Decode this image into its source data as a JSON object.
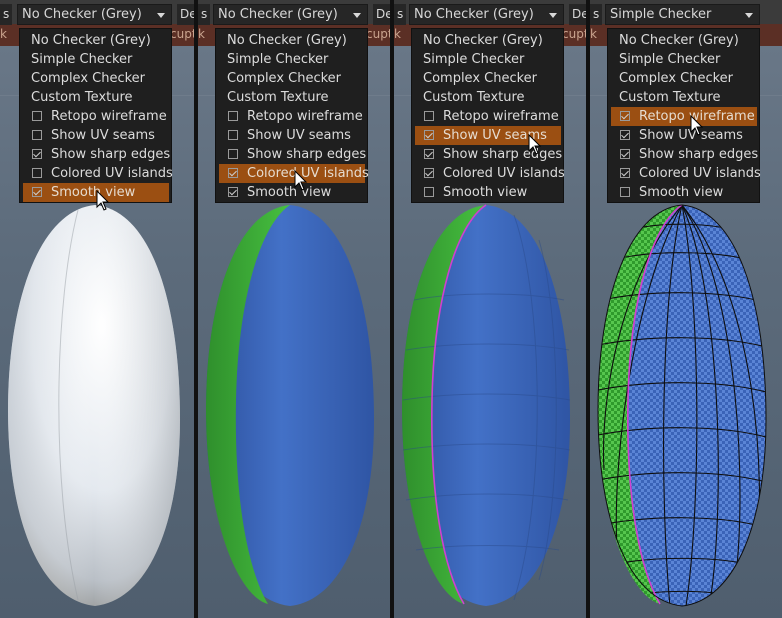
{
  "panels": [
    {
      "combo_value": "No Checker (Grey)",
      "left_label": "s",
      "right_label": "Des",
      "tab_left": "k",
      "tab_right": "cupt",
      "menu_items": [
        {
          "label": "No Checker (Grey)",
          "checkbox": false
        },
        {
          "label": "Simple Checker",
          "checkbox": false
        },
        {
          "label": "Complex Checker",
          "checkbox": false
        },
        {
          "label": "Custom Texture",
          "checkbox": false
        },
        {
          "label": "Retopo wireframe",
          "checkbox": true,
          "checked": false
        },
        {
          "label": "Show UV seams",
          "checkbox": true,
          "checked": false
        },
        {
          "label": "Show sharp edges",
          "checkbox": true,
          "checked": true
        },
        {
          "label": "Colored UV islands",
          "checkbox": true,
          "checked": false
        },
        {
          "label": "Smooth view",
          "checkbox": true,
          "checked": true
        }
      ],
      "highlighted": "Smooth view",
      "shading": "smooth-grey"
    },
    {
      "combo_value": "No Checker (Grey)",
      "left_label": "s",
      "right_label": "Des",
      "tab_left": "k",
      "tab_right": "cupt",
      "menu_items": [
        {
          "label": "No Checker (Grey)",
          "checkbox": false
        },
        {
          "label": "Simple Checker",
          "checkbox": false
        },
        {
          "label": "Complex Checker",
          "checkbox": false
        },
        {
          "label": "Custom Texture",
          "checkbox": false
        },
        {
          "label": "Retopo wireframe",
          "checkbox": true,
          "checked": false
        },
        {
          "label": "Show UV seams",
          "checkbox": true,
          "checked": false
        },
        {
          "label": "Show sharp edges",
          "checkbox": true,
          "checked": false
        },
        {
          "label": "Colored UV islands",
          "checkbox": true,
          "checked": true
        },
        {
          "label": "Smooth view",
          "checkbox": true,
          "checked": true
        }
      ],
      "highlighted": "Colored UV islands",
      "shading": "colored-smooth"
    },
    {
      "combo_value": "No Checker (Grey)",
      "left_label": "s",
      "right_label": "Des",
      "tab_left": "k",
      "tab_right": "cupt",
      "menu_items": [
        {
          "label": "No Checker (Grey)",
          "checkbox": false
        },
        {
          "label": "Simple Checker",
          "checkbox": false
        },
        {
          "label": "Complex Checker",
          "checkbox": false
        },
        {
          "label": "Custom Texture",
          "checkbox": false
        },
        {
          "label": "Retopo wireframe",
          "checkbox": true,
          "checked": false
        },
        {
          "label": "Show UV seams",
          "checkbox": true,
          "checked": true
        },
        {
          "label": "Show sharp edges",
          "checkbox": true,
          "checked": true
        },
        {
          "label": "Colored UV islands",
          "checkbox": true,
          "checked": true
        },
        {
          "label": "Smooth view",
          "checkbox": true,
          "checked": false
        }
      ],
      "highlighted": "Show UV seams",
      "shading": "colored-faceted-seams"
    },
    {
      "combo_value": "Simple Checker",
      "left_label": "s",
      "right_label": "",
      "tab_left": "k",
      "tab_right": "",
      "menu_items": [
        {
          "label": "No Checker (Grey)",
          "checkbox": false
        },
        {
          "label": "Simple Checker",
          "checkbox": false
        },
        {
          "label": "Complex Checker",
          "checkbox": false
        },
        {
          "label": "Custom Texture",
          "checkbox": false
        },
        {
          "label": "Retopo wireframe",
          "checkbox": true,
          "checked": true
        },
        {
          "label": "Show UV seams",
          "checkbox": true,
          "checked": true
        },
        {
          "label": "Show sharp edges",
          "checkbox": true,
          "checked": true
        },
        {
          "label": "Colored UV islands",
          "checkbox": true,
          "checked": true
        },
        {
          "label": "Smooth view",
          "checkbox": true,
          "checked": false
        }
      ],
      "highlighted": "Retopo wireframe",
      "shading": "checker-wireframe"
    }
  ],
  "colors": {
    "highlight": "#9b4f12",
    "island_blue": "#3a63b8",
    "island_green": "#3fae3a",
    "seam": "#d040d0",
    "wire": "#111111"
  },
  "icons": {
    "dropdown": "chevron-down-icon",
    "cursor": "mouse-pointer-icon",
    "checkbox": "checkbox-icon"
  }
}
